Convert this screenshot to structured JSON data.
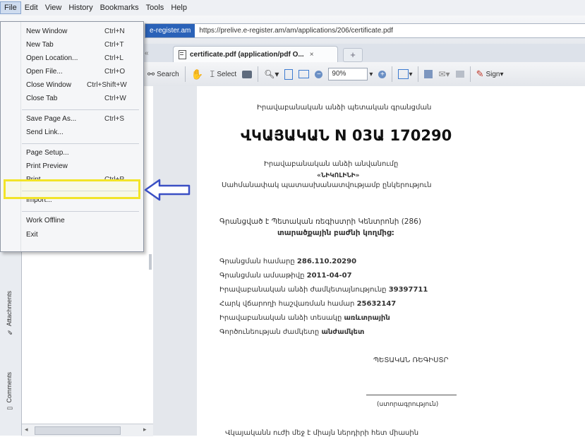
{
  "menubar": {
    "items": [
      "File",
      "Edit",
      "View",
      "History",
      "Bookmarks",
      "Tools",
      "Help"
    ]
  },
  "urlbar": {
    "site_identity": "e-register.am",
    "url": "https://prelive.e-register.am/am/applications/206/certificate.pdf"
  },
  "tab": {
    "label": "certificate.pdf (application/pdf O...",
    "close": "×",
    "new_tab": "+"
  },
  "toolbar": {
    "search_label": "Search",
    "select_label": "Select",
    "zoom_value": "90%",
    "sign_label": "Sign"
  },
  "file_menu": {
    "items": [
      {
        "label": "New Window",
        "shortcut": "Ctrl+N"
      },
      {
        "label": "New Tab",
        "shortcut": "Ctrl+T"
      },
      {
        "label": "Open Location...",
        "shortcut": "Ctrl+L"
      },
      {
        "label": "Open File...",
        "shortcut": "Ctrl+O"
      },
      {
        "label": "Close Window",
        "shortcut": "Ctrl+Shift+W"
      },
      {
        "label": "Close Tab",
        "shortcut": "Ctrl+W"
      },
      {
        "label": "Save Page As...",
        "shortcut": "Ctrl+S"
      },
      {
        "label": "Send Link...",
        "shortcut": ""
      },
      {
        "label": "Page Setup...",
        "shortcut": ""
      },
      {
        "label": "Print Preview",
        "shortcut": ""
      },
      {
        "label": "Print...",
        "shortcut": "Ctrl+P"
      },
      {
        "label": "Import...",
        "shortcut": ""
      },
      {
        "label": "Work Offline",
        "shortcut": ""
      },
      {
        "label": "Exit",
        "shortcut": ""
      }
    ]
  },
  "side_panel": {
    "attachments_label": "Attachments",
    "comments_label": "Comments"
  },
  "document": {
    "line_top": "Իրավաբանական անձի պետական գրանցման",
    "title": "ՎԿԱՅԱԿԱՆ N 03Ա 170290",
    "line_name_label": "Իրավաբանական անձի անվանումը",
    "line_name": "«ՆԻԿՈԼԻՆԻ»",
    "line_type": "Սահմանափակ պատասխանատվությամբ ընկերություն",
    "line_reg_1": "Գրանցված է Պետական ռեգիստրի Կենտրոնի (286)",
    "line_reg_2": "տարածքային բաժնի կողմից:",
    "reg_number_label": "Գրանցման համարը",
    "reg_number": "286.110.20290",
    "reg_date_label": "Գրանցման ամսաթիվը",
    "reg_date": "2011-04-07",
    "legal_term_label": "Իրավաբանական անձի ժամկետայնությունը",
    "legal_term": "39397711",
    "tax_id_label": "Հարկ վճարողի հաշվառման համար",
    "tax_id": "25632147",
    "legal_type_label": "Իրավաբանական անձի տեսակը",
    "legal_type": "առևտրային",
    "duration_label": "Գործունեության ժամկետը",
    "duration": "անժամկետ",
    "registrar": "ՊԵՏԱԿԱՆ ՌԵԳԻՍՏՐ",
    "signature_caption": "(ստորագրություն)",
    "bottom_line": "Վկայականն ուժի մեջ է միայն ներդիրի հետ միասին"
  }
}
